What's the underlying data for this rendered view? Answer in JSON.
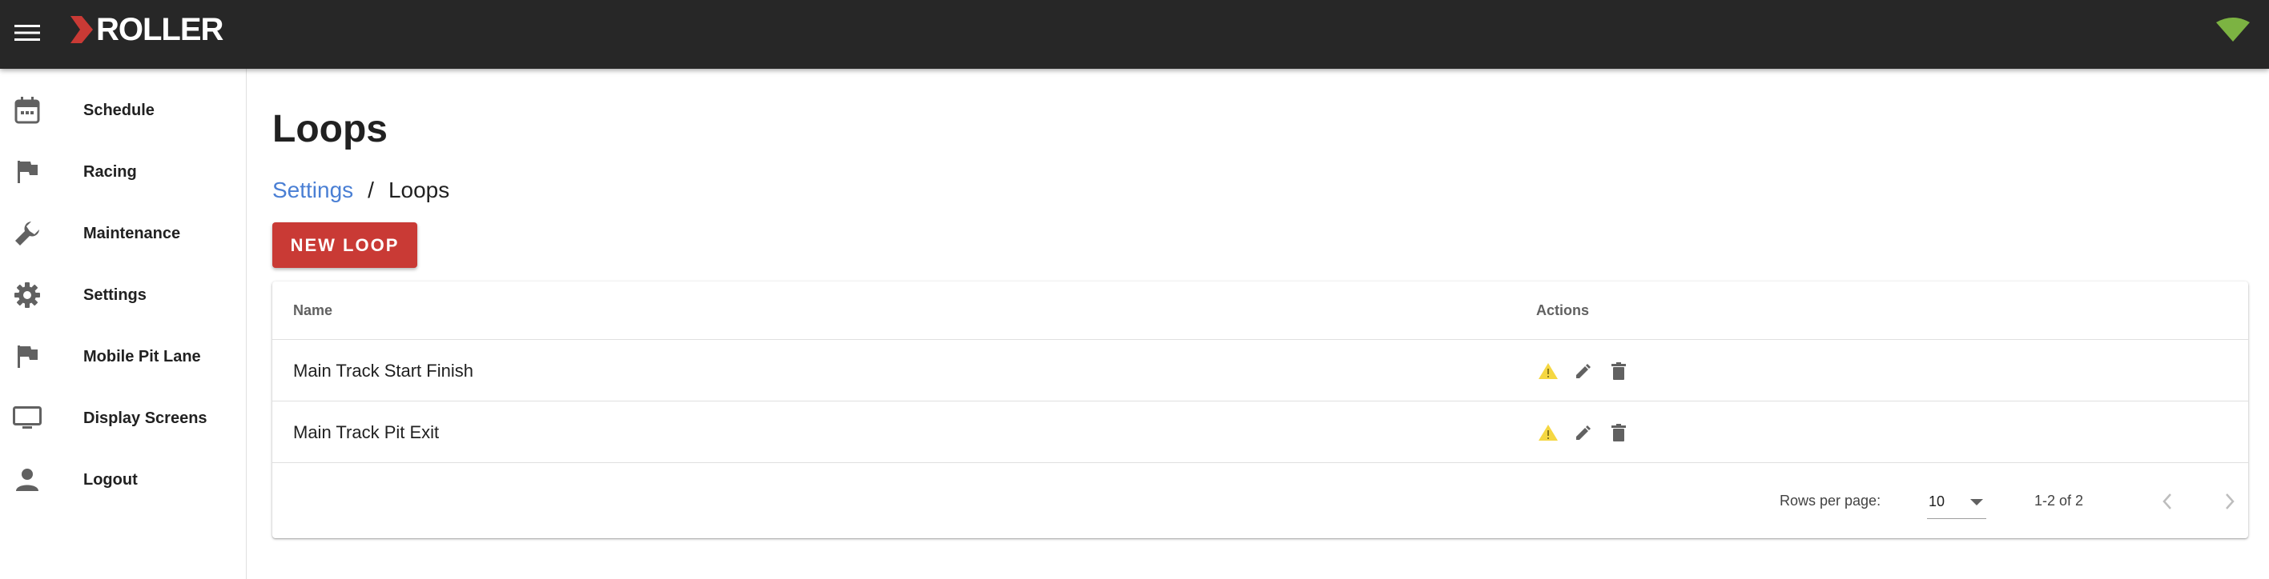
{
  "app": {
    "logo_text": "ROLLER",
    "brand_color": "#c93a35",
    "status_color": "#7cb342"
  },
  "sidebar": {
    "items": [
      {
        "label": "Schedule",
        "icon": "calendar-icon"
      },
      {
        "label": "Racing",
        "icon": "flag-icon"
      },
      {
        "label": "Maintenance",
        "icon": "wrench-icon"
      },
      {
        "label": "Settings",
        "icon": "gear-icon"
      },
      {
        "label": "Mobile Pit Lane",
        "icon": "flag-icon"
      },
      {
        "label": "Display Screens",
        "icon": "monitor-icon"
      },
      {
        "label": "Logout",
        "icon": "person-icon"
      }
    ]
  },
  "main": {
    "title": "Loops",
    "breadcrumb": {
      "parent": "Settings",
      "separator": "/",
      "current": "Loops"
    },
    "new_button": "NEW LOOP"
  },
  "table": {
    "columns": [
      "Name",
      "Actions"
    ],
    "rows": [
      {
        "name": "Main Track Start Finish",
        "actions": [
          "warning-icon",
          "edit-icon",
          "delete-icon"
        ]
      },
      {
        "name": "Main Track Pit Exit",
        "actions": [
          "warning-icon",
          "edit-icon",
          "delete-icon"
        ]
      }
    ],
    "footer": {
      "rows_per_page_label": "Rows per page:",
      "rows_per_page_value": "10",
      "range": "1-2 of 2"
    }
  }
}
